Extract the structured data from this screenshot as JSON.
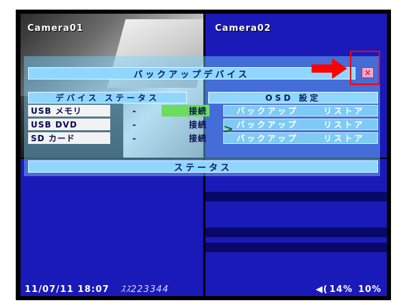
{
  "cameras": [
    {
      "name": "Camera01"
    },
    {
      "name": "Camera02"
    }
  ],
  "dialog": {
    "title": "バックアップデバイス",
    "close_icon": "×",
    "col_device_status": "デバイス ステータス",
    "col_osd": "OSD 設定",
    "rows": [
      {
        "device": "USB メモリ",
        "dash": "-",
        "state": "接続",
        "backup": "バックアップ",
        "restore": "リストア"
      },
      {
        "device": "USB DVD",
        "dash": "-",
        "state": "接続",
        "backup": "バックアップ",
        "restore": "リストア"
      },
      {
        "device": "SD カード",
        "dash": "-",
        "state": "接続",
        "backup": "バックアップ",
        "restore": "リストア"
      }
    ],
    "status_label": "ステータス"
  },
  "footer": {
    "datetime": "11/07/11 18:07",
    "id": "ｽｽ223344",
    "volume_icon": "◀(",
    "volume": "14%",
    "level": "10%"
  },
  "colors": {
    "accent_highlight": "#ff0000",
    "screen_blue": "#1a1ab8"
  }
}
